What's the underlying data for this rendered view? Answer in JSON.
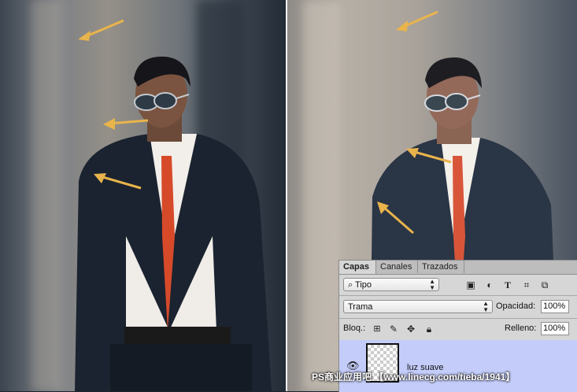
{
  "colors": {
    "arrow": "#e9b44c",
    "selected_layer": "#c4cdfa",
    "panel_bg": "#d6d6d6"
  },
  "panel": {
    "tabs": [
      {
        "label": "Capas",
        "active": true
      },
      {
        "label": "Canales",
        "active": false
      },
      {
        "label": "Trazados",
        "active": false
      }
    ],
    "filter": {
      "icon": "search-icon",
      "value": "Tipo"
    },
    "filter_icons": [
      "image-filter-icon",
      "adjustment-filter-icon",
      "type-filter-icon",
      "shape-filter-icon",
      "smart-object-filter-icon"
    ],
    "blend_mode": "Trama",
    "opacity_label": "Opacidad:",
    "opacity_value": "100%",
    "lock_label": "Bloq.:",
    "lock_icons": [
      "lock-transparency-icon",
      "lock-pixels-icon",
      "lock-position-icon",
      "lock-all-icon"
    ],
    "fill_label": "Relleno:",
    "fill_value": "100%",
    "layers": [
      {
        "name": "luz suave",
        "visible": true,
        "selected": true
      }
    ]
  },
  "watermark": "PS商业应用吧 【www.linecg.com/tieba/1941】"
}
